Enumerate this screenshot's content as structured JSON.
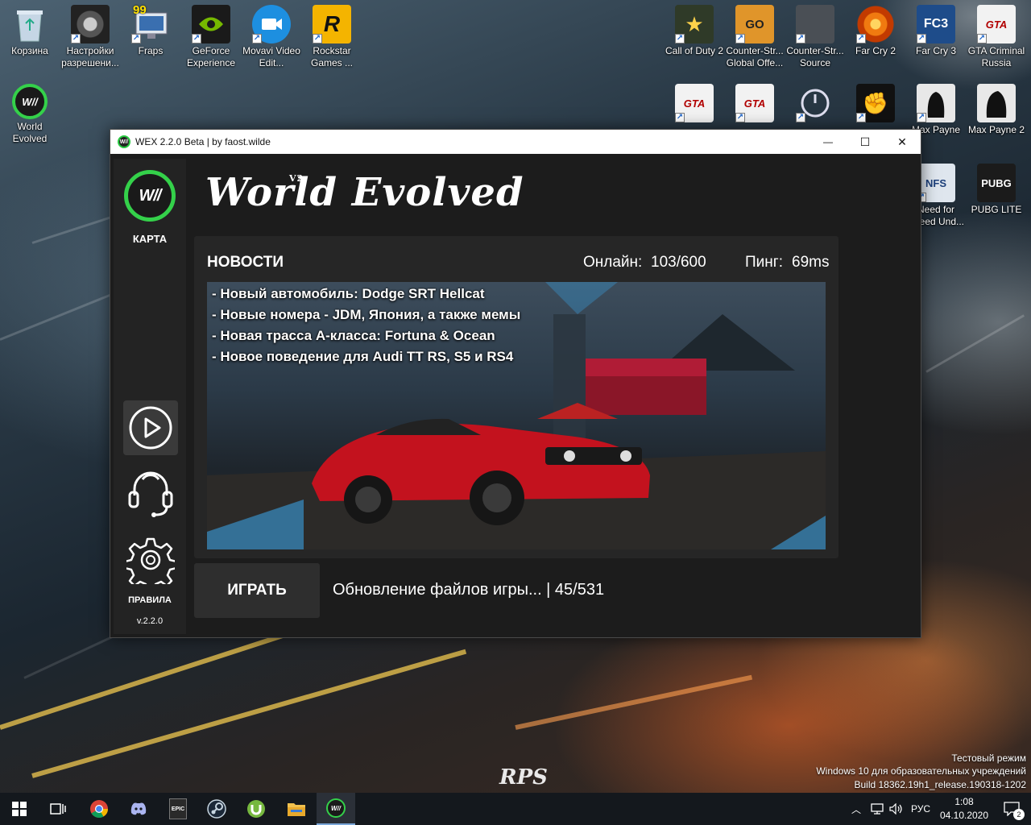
{
  "desktop": {
    "icons": [
      {
        "label": "Корзина",
        "icon": "recycle-bin-icon"
      },
      {
        "label": "Настройки разрешени...",
        "icon": "settings-icon"
      },
      {
        "label": "Fraps",
        "icon": "fraps-icon",
        "badge": "99"
      },
      {
        "label": "GeForce Experience",
        "icon": "nvidia-icon"
      },
      {
        "label": "Movavi Video Edit...",
        "icon": "movavi-icon"
      },
      {
        "label": "Rockstar Games ...",
        "icon": "rockstar-icon",
        "glyph": "R"
      },
      {
        "label": "World Evolved",
        "icon": "world-evolved-icon",
        "glyph": "W//"
      },
      {
        "label": "Call of Duty 2",
        "icon": "call-of-duty-icon"
      },
      {
        "label": "Counter-Str... Global Offe...",
        "icon": "csgo-icon",
        "glyph": "GO"
      },
      {
        "label": "Counter-Str... Source",
        "icon": "cs-source-icon"
      },
      {
        "label": "Far Cry 2",
        "icon": "far-cry-2-icon"
      },
      {
        "label": "Far Cry 3",
        "icon": "far-cry-3-icon",
        "glyph": "FC3"
      },
      {
        "label": "GTA Criminal Russia",
        "icon": "gta-icon",
        "glyph": "GTA"
      },
      {
        "label": "",
        "icon": "gta-icon",
        "glyph": "GTA"
      },
      {
        "label": "",
        "icon": "gta-icon",
        "glyph": "GTA"
      },
      {
        "label": "",
        "icon": "power-icon"
      },
      {
        "label": "",
        "icon": "fist-icon"
      },
      {
        "label": "Max Payne",
        "icon": "max-payne-icon"
      },
      {
        "label": "Max Payne 2",
        "icon": "max-payne-2-icon"
      },
      {
        "label": "Need for Speed Und...",
        "icon": "nfs-icon",
        "glyph": "NFS"
      },
      {
        "label": "PUBG LITE",
        "icon": "pubg-icon",
        "glyph": "PUBG"
      }
    ],
    "watermark": {
      "line1": "Тестовый режим",
      "line2": "Windows 10 для образовательных учреждений",
      "line3": "Build 18362.19h1_release.190318-1202"
    },
    "wallpaper_brand": "RPS"
  },
  "launcher": {
    "window_title": "WEX 2.2.0 Beta | by faost.wilde",
    "app_icon_glyph": "W//",
    "controls": {
      "minimize": "—",
      "maximize": "☐",
      "close": "✕"
    },
    "sidebar": {
      "logo_glyph": "W//",
      "map_label": "КАРТА",
      "rules_label": "ПРАВИЛА",
      "version": "v.2.2.0"
    },
    "header": {
      "title": "World Evolved",
      "superscript": "V2"
    },
    "news": {
      "heading": "НОВОСТИ",
      "online_label": "Онлайн:",
      "online_value": "103/600",
      "ping_label": "Пинг:",
      "ping_value": "69ms",
      "items": [
        "- Новый автомобиль: Dodge SRT Hellcat",
        "- Новые номера - JDM, Япония, а также мемы",
        "- Новая трасса A-класса: Fortuna & Ocean",
        "- Новое поведение для Audi TT RS, S5 и RS4"
      ]
    },
    "play_label": "ИГРАТЬ",
    "update_status": "Обновление файлов игры... | 45/531"
  },
  "taskbar": {
    "apps": [
      {
        "name": "windows-start-icon"
      },
      {
        "name": "task-view-icon"
      },
      {
        "name": "chrome-icon"
      },
      {
        "name": "discord-icon"
      },
      {
        "name": "epic-games-icon",
        "glyph": "EPIC"
      },
      {
        "name": "steam-icon"
      },
      {
        "name": "utorrent-icon"
      },
      {
        "name": "file-explorer-icon"
      },
      {
        "name": "world-evolved-taskbar-icon",
        "glyph": "W//"
      }
    ],
    "language": "РУС",
    "time": "1:08",
    "date": "04.10.2020",
    "notifications": "2"
  },
  "colors": {
    "accent_green": "#34d14a",
    "panel_bg": "#262626",
    "window_bg": "#1c1c1c"
  }
}
